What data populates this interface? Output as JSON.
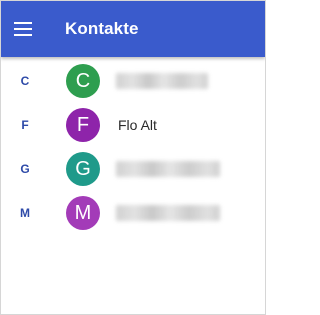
{
  "app_bar": {
    "title": "Kontakte",
    "color": "#3a5bcc",
    "menu_icon": "hamburger-menu-icon"
  },
  "contacts": [
    {
      "section": "C",
      "initial": "C",
      "avatar_color": "#2e9e4f",
      "name": "",
      "redacted": true
    },
    {
      "section": "F",
      "initial": "F",
      "avatar_color": "#8e24aa",
      "name": "Flo Alt",
      "redacted": false
    },
    {
      "section": "G",
      "initial": "G",
      "avatar_color": "#1f9a8a",
      "name": "",
      "redacted": true
    },
    {
      "section": "M",
      "initial": "M",
      "avatar_color": "#a33bb8",
      "name": "",
      "redacted": true
    }
  ]
}
